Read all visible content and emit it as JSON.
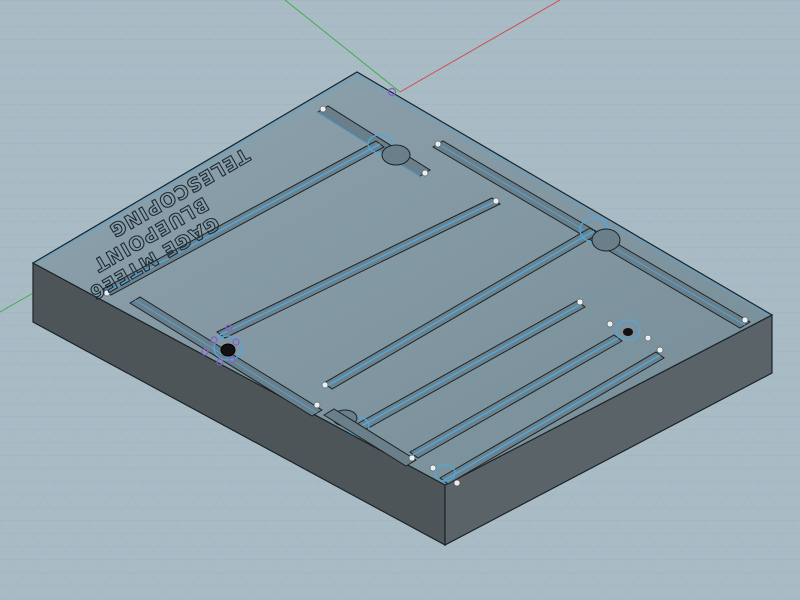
{
  "scene": {
    "engraving": {
      "line1": "TELESCOPING",
      "line2": "BLUEPOINT",
      "line3": "GAGE MTEE6"
    },
    "colors": {
      "background": "#a9bcc6",
      "grid": "#8fa3ae",
      "top_face": "#7c929d",
      "front_face": "#4d5558",
      "right_face": "#5a6368",
      "edge": "#1c2428",
      "selection_highlight": "#4fa9e0",
      "axis_x": "#d04a4a",
      "axis_y": "#3fae4a",
      "sketch_point": "#8a5fc4"
    },
    "icons": {
      "selection_outline": "blue-highlight",
      "sketch_points": "purple-dots"
    }
  }
}
